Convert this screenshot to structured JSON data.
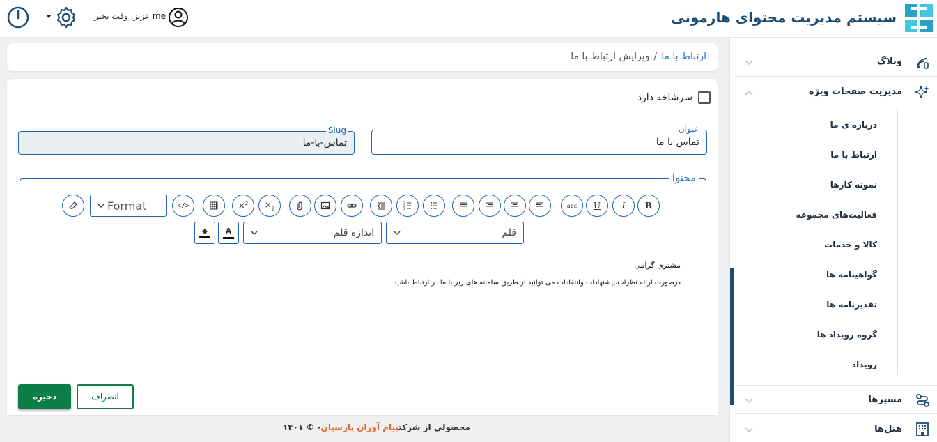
{
  "header": {
    "app_title": "سیستم مدیریت محتوای هارمونی",
    "greeting": "me عزیز، وقت بخیر",
    "colors": {
      "brand": "#1d4d73",
      "accent": "#0e7e49",
      "link": "#2672d6"
    }
  },
  "sidebar": {
    "items": [
      {
        "label": "وبلاگ",
        "icon": "blog-rss-icon"
      },
      {
        "label": "مدیریت صفحات ویژه",
        "icon": "sparkles-icon"
      },
      {
        "label": "مسیرها",
        "icon": "route-icon"
      },
      {
        "label": "هتل‌ها",
        "icon": "hotel-building-icon"
      }
    ],
    "subitems": [
      "درباره ی ما",
      "ارتباط با ما",
      "نمونه کارها",
      "فعالیت‌های مجموعه",
      "کالا و خدمات",
      "گواهینامه ها",
      "تقدیرنامه ها",
      "گروه رویداد ها",
      "رویداد"
    ]
  },
  "breadcrumb": {
    "link": "ارتباط با ما",
    "separator": "/",
    "current": "ویرایش ارتباط با ما"
  },
  "form": {
    "has_header_label": "سرشاخه دارد",
    "title_label": "عنوان",
    "title_value": "تماس با ما",
    "slug_label": "Slug",
    "slug_value": "تماس-با-ما",
    "content_label": "محتوا"
  },
  "editor": {
    "format_label": "Format",
    "font_label": "قلم",
    "font_size_label": "اندازه قلم",
    "bold": "B",
    "italic": "I",
    "underline": "U",
    "strike": "abc",
    "content_line1": "مشتری گرامی",
    "content_line2": "درصورت ارائه نظرات،پیشنهادات وانتقادات می توانید از طریق سامانه های زیر با ما در ارتباط باشید"
  },
  "actions": {
    "save": "ذخیره",
    "cancel": "انصراف"
  },
  "footer": {
    "prefix": "محصولی از شرکت",
    "company": "پیام آوران پارسیان",
    "suffix": "- © ۱۴۰۱"
  }
}
